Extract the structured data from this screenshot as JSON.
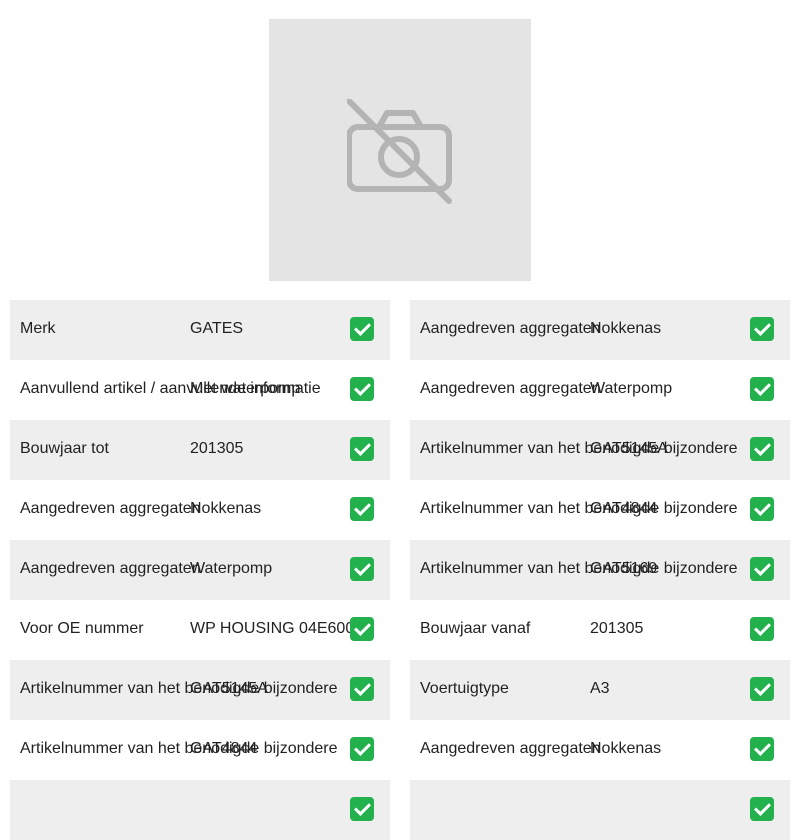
{
  "image_placeholder": {
    "icon": "no-photo-icon"
  },
  "left_rows": [
    {
      "label": "Merk",
      "value": "GATES"
    },
    {
      "label": "Aanvullend artikel / aanvullende informatie",
      "value": "Met waterpomp"
    },
    {
      "label": "Bouwjaar tot",
      "value": "201305"
    },
    {
      "label": "Aangedreven aggregaten",
      "value": "Nokkenas"
    },
    {
      "label": "Aangedreven aggregaten",
      "value": "Waterpomp"
    },
    {
      "label": "Voor OE nummer",
      "value": "WP HOUSING 04E600"
    },
    {
      "label": "Artikelnummer van het benodigde bijzondere",
      "value": "GAT5145A"
    },
    {
      "label": "Artikelnummer van het benodigde bijzondere",
      "value": "GAT4844"
    },
    {
      "label": "",
      "value": ""
    }
  ],
  "right_rows": [
    {
      "label": "Aangedreven aggregaten",
      "value": "Nokkenas"
    },
    {
      "label": "Aangedreven aggregaten",
      "value": "Waterpomp"
    },
    {
      "label": "Artikelnummer van het benodigde bijzondere",
      "value": "GAT5145A"
    },
    {
      "label": "Artikelnummer van het benodigde bijzondere",
      "value": "GAT4844"
    },
    {
      "label": "Artikelnummer van het benodigde bijzondere",
      "value": "GAT5169"
    },
    {
      "label": "Bouwjaar vanaf",
      "value": "201305"
    },
    {
      "label": "Voertuigtype",
      "value": "A3"
    },
    {
      "label": "Aangedreven aggregaten",
      "value": "Nokkenas"
    },
    {
      "label": "",
      "value": ""
    }
  ],
  "check_icon": "checkmark-icon",
  "colors": {
    "row_alt": "#eeeeee",
    "check_green": "#22b14c",
    "placeholder_bg": "#e4e4e4"
  }
}
